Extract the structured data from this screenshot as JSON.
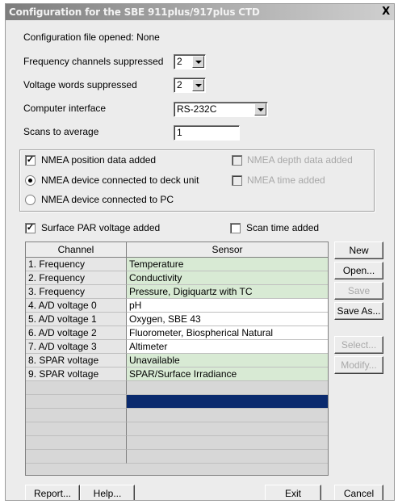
{
  "window": {
    "title": "Configuration for the SBE 911plus/917plus CTD",
    "close_label": "X"
  },
  "config_file": {
    "label": "Configuration file opened:",
    "value": "None"
  },
  "fields": {
    "freq_suppressed": {
      "label": "Frequency channels suppressed",
      "value": "2"
    },
    "voltage_suppressed": {
      "label": "Voltage words suppressed",
      "value": "2"
    },
    "computer_interface": {
      "label": "Computer interface",
      "value": "RS-232C"
    },
    "scans_to_average": {
      "label": "Scans to average",
      "value": "1"
    }
  },
  "nmea": {
    "position_added": {
      "label": "NMEA position data added",
      "checked": true
    },
    "depth_added": {
      "label": "NMEA depth data added",
      "checked": false,
      "enabled": false
    },
    "deck_unit": {
      "label": "NMEA device connected to deck unit",
      "selected": true
    },
    "time_added": {
      "label": "NMEA time added",
      "checked": false,
      "enabled": false
    },
    "to_pc": {
      "label": "NMEA device connected to PC",
      "selected": false
    }
  },
  "options": {
    "surface_par": {
      "label": "Surface PAR voltage added",
      "checked": true
    },
    "scan_time": {
      "label": "Scan time added",
      "checked": false
    }
  },
  "table": {
    "headers": {
      "channel": "Channel",
      "sensor": "Sensor"
    },
    "rows": [
      {
        "channel": "1. Frequency",
        "sensor": "Temperature"
      },
      {
        "channel": "2. Frequency",
        "sensor": "Conductivity"
      },
      {
        "channel": "3. Frequency",
        "sensor": "Pressure, Digiquartz with TC"
      },
      {
        "channel": "4. A/D voltage 0",
        "sensor": "pH"
      },
      {
        "channel": "5. A/D voltage 1",
        "sensor": "Oxygen, SBE 43"
      },
      {
        "channel": "6. A/D voltage 2",
        "sensor": "Fluorometer, Biospherical Natural"
      },
      {
        "channel": "7. A/D voltage 3",
        "sensor": "Altimeter"
      },
      {
        "channel": "8. SPAR voltage",
        "sensor": "Unavailable"
      },
      {
        "channel": "9. SPAR voltage",
        "sensor": "SPAR/Surface Irradiance"
      },
      {
        "channel": "",
        "sensor": ""
      },
      {
        "channel": "",
        "sensor": ""
      },
      {
        "channel": "",
        "sensor": ""
      },
      {
        "channel": "",
        "sensor": ""
      },
      {
        "channel": "",
        "sensor": ""
      },
      {
        "channel": "",
        "sensor": ""
      }
    ]
  },
  "side_buttons": {
    "new": "New",
    "open": "Open...",
    "save": "Save",
    "save_as": "Save As...",
    "select": "Select...",
    "modify": "Modify..."
  },
  "bottom_buttons": {
    "report": "Report...",
    "help": "Help...",
    "exit": "Exit",
    "cancel": "Cancel"
  },
  "colors": {
    "sensor_green": "#d8ead4",
    "selection_blue": "#0a2a6e"
  }
}
